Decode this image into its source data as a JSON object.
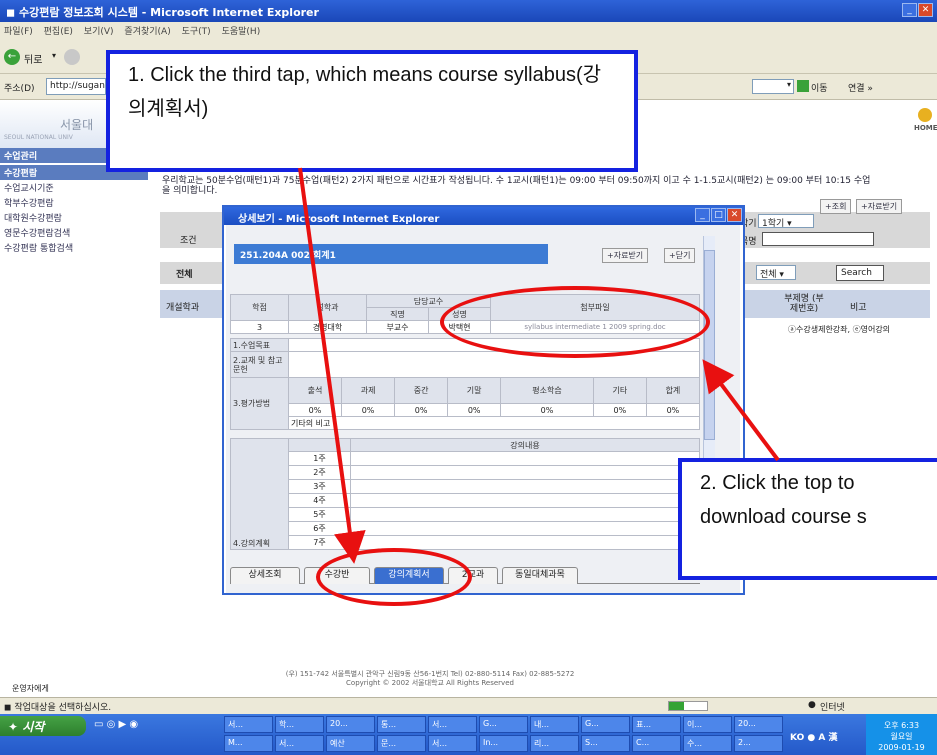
{
  "window": {
    "title": "수강편람 정보조회 시스템 - Microsoft Internet Explorer",
    "menu": [
      "파일(F)",
      "편집(E)",
      "보기(V)",
      "즐겨찾기(A)",
      "도구(T)",
      "도움말(H)"
    ],
    "back_label": "뒤로",
    "address_label": "주소(D)",
    "address_value": "http://sugang",
    "go_label": "이동",
    "links_label": "연결 »"
  },
  "leftnav": {
    "logo_text": "서울대",
    "logo_sub": "SEOUL NATIONAL UNIV",
    "section1": "수업관리",
    "section2": "수강편람",
    "items": [
      "수업교시기준",
      "학부수강편람",
      "대학원수강편람",
      "영문수강편람검색",
      "수강편람 통합검색"
    ]
  },
  "main": {
    "home_label": "HOME",
    "notice_line1": "우리학교는 50분수업(패턴1)과 75분수업(패턴2) 2가지 패턴으로 시간표가 작성됩니다. 수 1교시(패턴1)는 09:00 부터 09:50까지 이고 수 1-1.5교시(패턴2) 는 09:00 부터 10:15 수업",
    "notice_line2": "을 의미합니다.",
    "search_btn": "+조회",
    "download_btn": "+자료받기",
    "condition_label": "조건",
    "total_label": "전체",
    "semester_value": "1학기",
    "year_label": "학기",
    "course_name_label": "목명",
    "all_select": "전체",
    "search_label": "Search",
    "col_dept": "개설학과",
    "col_dept_code": "부제명 (부제번호)",
    "col_note": "비고",
    "legend_text": "ⓐ수강생제한강좌, ⓔ영어강의"
  },
  "popup": {
    "title": "상세보기 - Microsoft Internet Explorer",
    "course_code": "251.204A 002 회계1",
    "download_btn": "+자료받기",
    "close_btn": "+닫기",
    "head_credit": "학점",
    "head_dept": "설학과",
    "head_prof": "담당교수",
    "head_position": "직명",
    "head_name": "성명",
    "head_attach": "첨부파일",
    "credit": "3",
    "dept": "경영대학",
    "position": "부교수",
    "prof_name": "박택현",
    "attach_file": "syllabus intermediate 1 2009 spring.doc",
    "row_goal": "1.수업목표",
    "row_text": "2.교재 및 참고문헌",
    "row_eval": "3.평가방법",
    "eval_cols": [
      "출석",
      "과제",
      "중간",
      "기말",
      "평소학습",
      "기타",
      "합계"
    ],
    "eval_vals": [
      "0%",
      "0%",
      "0%",
      "0%",
      "0%",
      "0%",
      "0%"
    ],
    "eval_note": "기타의 비고 :",
    "row_plan": "4.강의계획",
    "plan_header": "강의내용",
    "weeks": [
      "1주",
      "2주",
      "3주",
      "4주",
      "5주",
      "6주",
      "7주"
    ],
    "tabs": [
      "상세조회",
      "수강반",
      "강의계획서",
      "2교과",
      "동일대체과목"
    ]
  },
  "footer": {
    "line1": "(우) 151-742 서울특별시 관악구 신림9동 산56-1번지 Tel) 02-880-5114 Fax) 02-885-5272",
    "line2": "Copyright © 2002 서울대학교 All Rights Reserved",
    "admin": "운영자에게"
  },
  "status": {
    "text": "작업대상을 선택하십시오.",
    "zone": "인터넷"
  },
  "taskbar": {
    "start": "시작",
    "row1": [
      "서...",
      "학...",
      "20...",
      "통...",
      "서...",
      "G...",
      "내...",
      "G...",
      "표...",
      "이...",
      "20..."
    ],
    "row2": [
      "M...",
      "서...",
      "예산",
      "문...",
      "서...",
      "In...",
      "리...",
      "S...",
      "C...",
      "수...",
      "2..."
    ],
    "clock": "오후 6:33",
    "day": "월요일",
    "date": "2009-01-19"
  },
  "callouts": {
    "one": "1. Click the third tap, which means course syllabus(강의계획서)",
    "two": "2. Click the top to download course s"
  },
  "colors": {
    "annotation_box": "#1422e0",
    "annotation_mark": "#e81010",
    "xp_blue": "#2459c9"
  }
}
